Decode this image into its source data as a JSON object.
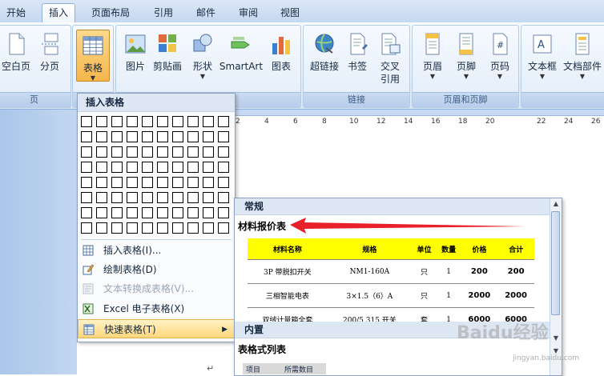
{
  "tabs": [
    "开始",
    "插入",
    "页面布局",
    "引用",
    "邮件",
    "审阅",
    "视图"
  ],
  "active_tab": "插入",
  "ribbon": {
    "groups": [
      {
        "label": "页",
        "buttons": [
          "空白页",
          "分页"
        ]
      },
      {
        "label": "",
        "buttons": [
          "表格"
        ]
      },
      {
        "label": "",
        "buttons": [
          "图片",
          "剪贴画",
          "形状",
          "SmartArt",
          "图表"
        ]
      },
      {
        "label": "链接",
        "buttons": [
          "超链接",
          "书签",
          "交叉引用"
        ]
      },
      {
        "label": "页眉和页脚",
        "buttons": [
          "页眉",
          "页脚",
          "页码"
        ]
      },
      {
        "label": "",
        "buttons": [
          "文本框",
          "文档部件"
        ]
      }
    ],
    "cross_ref_line1": "交叉",
    "cross_ref_line2": "引用"
  },
  "ruler_ticks": [
    "2",
    "4",
    "6",
    "8",
    "10",
    "12",
    "14",
    "16",
    "18",
    "20",
    "22",
    "24",
    "26"
  ],
  "insert_table_menu": {
    "header": "插入表格",
    "grid_cols": 10,
    "grid_rows": 8,
    "items": [
      {
        "label": "插入表格(I)...",
        "enabled": true
      },
      {
        "label": "绘制表格(D)",
        "enabled": true
      },
      {
        "label": "文本转换成表格(V)...",
        "enabled": false
      },
      {
        "label": "Excel 电子表格(X)",
        "enabled": true
      },
      {
        "label": "快速表格(T)",
        "enabled": true,
        "submenu": true
      }
    ]
  },
  "quick_tables": {
    "section1": "常规",
    "section2": "内置",
    "item1_title": "材料报价表",
    "item2_title": "表格式列表",
    "price_table": {
      "headers": [
        "材料名称",
        "规格",
        "单位",
        "数量",
        "价格",
        "合计"
      ],
      "rows": [
        [
          "3P 带脱扣开关",
          "NM1-160A",
          "只",
          "1",
          "200",
          "200"
        ],
        [
          "三相智能电表",
          "3×1.5（6）A",
          "只",
          "1",
          "2000",
          "2000"
        ],
        [
          "双绒计量箱全套",
          "200/5 315 开关",
          "套",
          "1",
          "6000",
          "6000"
        ]
      ]
    },
    "list_preview_headers": [
      "项目",
      "所需数目"
    ]
  },
  "watermark": "Baidu经验",
  "watermark_url": "jingyan.baidu.com",
  "colors": {
    "header_yellow": "#ffff00",
    "arrow_red": "#e8202a",
    "menu_highlight": "#ffd67a"
  }
}
